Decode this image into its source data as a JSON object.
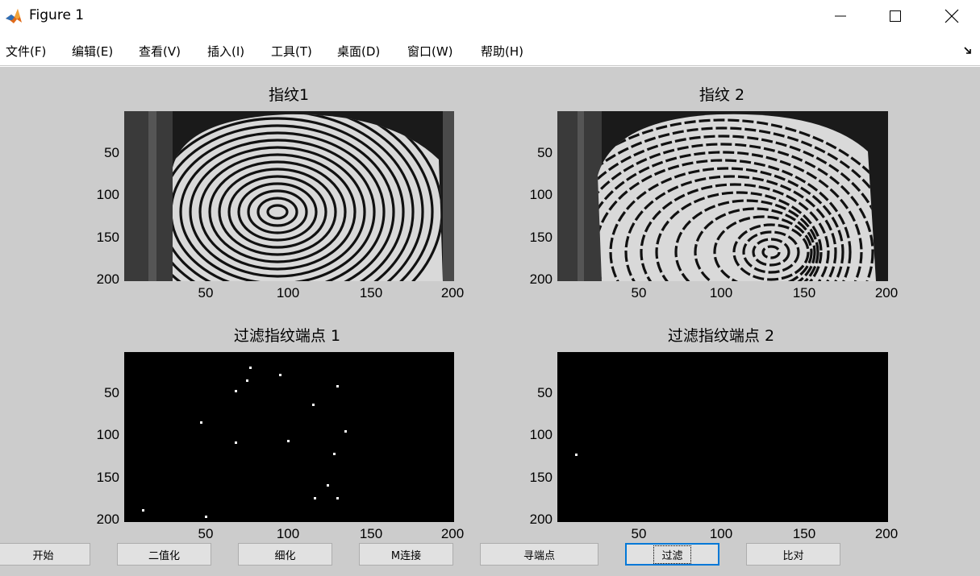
{
  "window": {
    "title": "Figure 1",
    "icon": "matlab-icon",
    "controls": [
      "minimize-icon",
      "maximize-icon",
      "close-icon"
    ]
  },
  "menu": {
    "items": [
      "文件(F)",
      "编辑(E)",
      "查看(V)",
      "插入(I)",
      "工具(T)",
      "桌面(D)",
      "窗口(W)",
      "帮助(H)"
    ],
    "dock_icon": "dock-arrow-icon"
  },
  "figure": {
    "background": "#cccccc",
    "axes": [
      {
        "title": "指纹1",
        "xticks": [
          "50",
          "100",
          "150",
          "200"
        ],
        "yticks": [
          "50",
          "100",
          "150",
          "200"
        ],
        "content": "fingerprint-image-1"
      },
      {
        "title": "指纹 2",
        "xticks": [
          "50",
          "100",
          "150",
          "200"
        ],
        "yticks": [
          "50",
          "100",
          "150",
          "200"
        ],
        "content": "fingerprint-image-2"
      },
      {
        "title": "过滤指纹端点 1",
        "xticks": [
          "50",
          "100",
          "150",
          "200"
        ],
        "yticks": [
          "50",
          "100",
          "150",
          "200"
        ],
        "content": "minutiae-points-1",
        "points": [
          [
            77,
            18
          ],
          [
            95,
            27
          ],
          [
            75,
            34
          ],
          [
            68,
            46
          ],
          [
            130,
            40
          ],
          [
            115,
            62
          ],
          [
            47,
            83
          ],
          [
            135,
            94
          ],
          [
            68,
            107
          ],
          [
            100,
            105
          ],
          [
            128,
            121
          ],
          [
            124,
            158
          ],
          [
            130,
            173
          ],
          [
            116,
            173
          ],
          [
            12,
            188
          ],
          [
            50,
            195
          ]
        ]
      },
      {
        "title": "过滤指纹端点 2",
        "xticks": [
          "50",
          "100",
          "150",
          "200"
        ],
        "yticks": [
          "50",
          "100",
          "150",
          "200"
        ],
        "content": "minutiae-points-2",
        "points": [
          [
            12,
            122
          ]
        ]
      }
    ]
  },
  "buttons": [
    {
      "label": "开始"
    },
    {
      "label": "二值化"
    },
    {
      "label": "细化"
    },
    {
      "label": "M连接"
    },
    {
      "label": "寻端点"
    },
    {
      "label": "过滤"
    },
    {
      "label": "比对"
    }
  ]
}
